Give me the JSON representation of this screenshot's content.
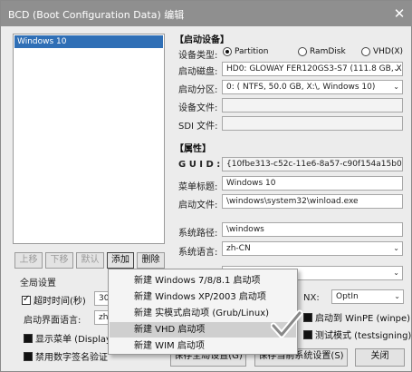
{
  "window": {
    "title": "BCD (Boot Configuration Data) 编辑",
    "close_glyph": "✕"
  },
  "entries": [
    "Windows 10"
  ],
  "boot_device": {
    "group_title": "【启动设备】",
    "device_type_label": "设备类型:",
    "device_type_options": [
      "Partition",
      "RamDisk",
      "VHD(X)"
    ],
    "selected_type": "Partition",
    "boot_disk_label": "启动磁盘:",
    "boot_disk_value": "HD0: GLOWAY FER120GS3-S7 (111.8 GB, X: Y:",
    "boot_partition_label": "启动分区:",
    "boot_partition_value": "0: ( NTFS,  50.0 GB, X:\\, Windows 10)",
    "device_file_label": "设备文件:",
    "device_file_value": "",
    "sdi_file_label": "SDI 文件:",
    "sdi_file_value": ""
  },
  "properties": {
    "group_title": "【属性】",
    "guid_label": "G U I D :",
    "guid_value": "{10fbe313-c52c-11e6-8a57-c90f154a15b0}",
    "menu_title_label": "菜单标题:",
    "menu_title_value": "Windows 10",
    "boot_file_label": "启动文件:",
    "boot_file_value": "\\windows\\system32\\winload.exe",
    "system_path_label": "系统路径:",
    "system_path_value": "\\windows",
    "system_language_label": "系统语言:",
    "system_language_value": "zh-CN"
  },
  "list_buttons": {
    "up": "上移",
    "down": "下移",
    "default": "默认",
    "add": "添加",
    "delete": "删除"
  },
  "global": {
    "title": "全局设置",
    "timeout_label": "超时时间(秒)",
    "timeout_value": "30",
    "menu_language_label": "启动界面语言:",
    "menu_language_value": "zh-",
    "show_menu_label": "显示菜单 (DisplayBo",
    "disable_sig_label": "禁用数字签名验证"
  },
  "right_extra": {
    "nx_label": "NX:",
    "nx_value": "OptIn",
    "boot_winpe_label": "启动到 WinPE (winpe)",
    "test_mode_label": "测试模式 (testsigning)"
  },
  "add_menu": {
    "items": [
      "新建 Windows 7/8/8.1 启动项",
      "新建 Windows XP/2003 启动项",
      "新建 实模式启动项 (Grub/Linux)",
      "新建 VHD 启动项",
      "新建 WIM 启动项"
    ],
    "highlighted_index": 3
  },
  "footer": {
    "save_global": "保存全局设置(G)",
    "save_current": "保存当前系统设置(S)",
    "close": "关闭"
  },
  "colors": {
    "selection": "#2f6fb6",
    "title_bar": "#8f8f8f",
    "menu_highlight": "#cfcfcf"
  }
}
